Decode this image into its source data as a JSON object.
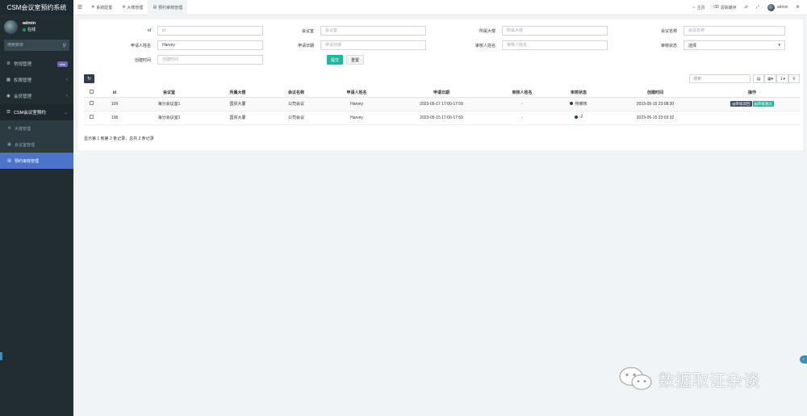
{
  "app": {
    "title": "CSM会议室预约系统"
  },
  "user": {
    "name": "admin",
    "status": "在线"
  },
  "sidebar": {
    "search_placeholder": "搜索菜单",
    "items": [
      {
        "icon": "gears-icon",
        "glyph": "⚙",
        "label": "常规管理",
        "badge": "new"
      },
      {
        "icon": "users-icon",
        "glyph": "▦",
        "label": "权限管理",
        "chevron": "‹"
      },
      {
        "icon": "user-circle-icon",
        "glyph": "◉",
        "label": "会员管理",
        "chevron": "‹"
      },
      {
        "icon": "list-icon",
        "glyph": "☰",
        "label": "CSM会议室预约",
        "chevron": "⌄"
      }
    ],
    "subitems": [
      {
        "icon": "gear-icon",
        "glyph": "✲",
        "label": "大楼管理"
      },
      {
        "icon": "door-icon",
        "glyph": "▣",
        "label": "会议室管理"
      },
      {
        "icon": "file-icon",
        "glyph": "▤",
        "label": "预约审核管理"
      }
    ]
  },
  "header": {
    "tabs": [
      {
        "glyph": "✲",
        "label": "系统配置"
      },
      {
        "glyph": "✲",
        "label": "大楼管理"
      },
      {
        "glyph": "▤",
        "label": "预约审核管理"
      }
    ],
    "right": {
      "home": "主页",
      "clear_cache": "清除缓存",
      "admin": "admin"
    }
  },
  "form": {
    "id_label": "id",
    "id_placeholder": "id",
    "room_label": "会议室",
    "room_placeholder": "会议室",
    "building_label": "所属大楼",
    "building_placeholder": "所属大楼",
    "meeting_label": "会议名称",
    "meeting_placeholder": "会议名称",
    "applicant_label": "申请人姓名",
    "applicant_value": "Harvey",
    "date_label": "申请日期",
    "date_placeholder": "申请日期",
    "reviewer_label": "审核人姓名",
    "reviewer_placeholder": "审核人姓名",
    "status_label": "审核状态",
    "status_value": "选择",
    "created_label": "创建时间",
    "created_placeholder": "创建时间",
    "submit": "提交",
    "reset": "重置"
  },
  "toolbar": {
    "search_placeholder": "搜索"
  },
  "table": {
    "headers": [
      "id",
      "会议室",
      "所属大楼",
      "会议名称",
      "申请人姓名",
      "申请日期",
      "审核人姓名",
      "审核状态",
      "创建时间",
      "操作"
    ],
    "rows": [
      {
        "id": "109",
        "room": "海分会议室1",
        "building": "国贸大厦",
        "meeting": "公司会议",
        "applicant": "Harvey",
        "date": "2023-05-17 17:00-17:59",
        "reviewer": "-",
        "status": "待审核",
        "created": "2023-05-15 23:08:30",
        "ops": [
          "审核驳回",
          "审核通过"
        ]
      },
      {
        "id": "108",
        "room": "海分会议室1",
        "building": "国贸大厦",
        "meeting": "公司会议",
        "applicant": "Harvey",
        "date": "2023-05-15 17:00-17:59",
        "reviewer": "-",
        "status": "-2",
        "created": "2023-05-15 23:03:32",
        "ops": []
      }
    ]
  },
  "pagination": {
    "info": "显示第 1 到第 2 条记录，总共 2 条记录"
  },
  "watermark": {
    "text": "数据取证杂谈"
  }
}
